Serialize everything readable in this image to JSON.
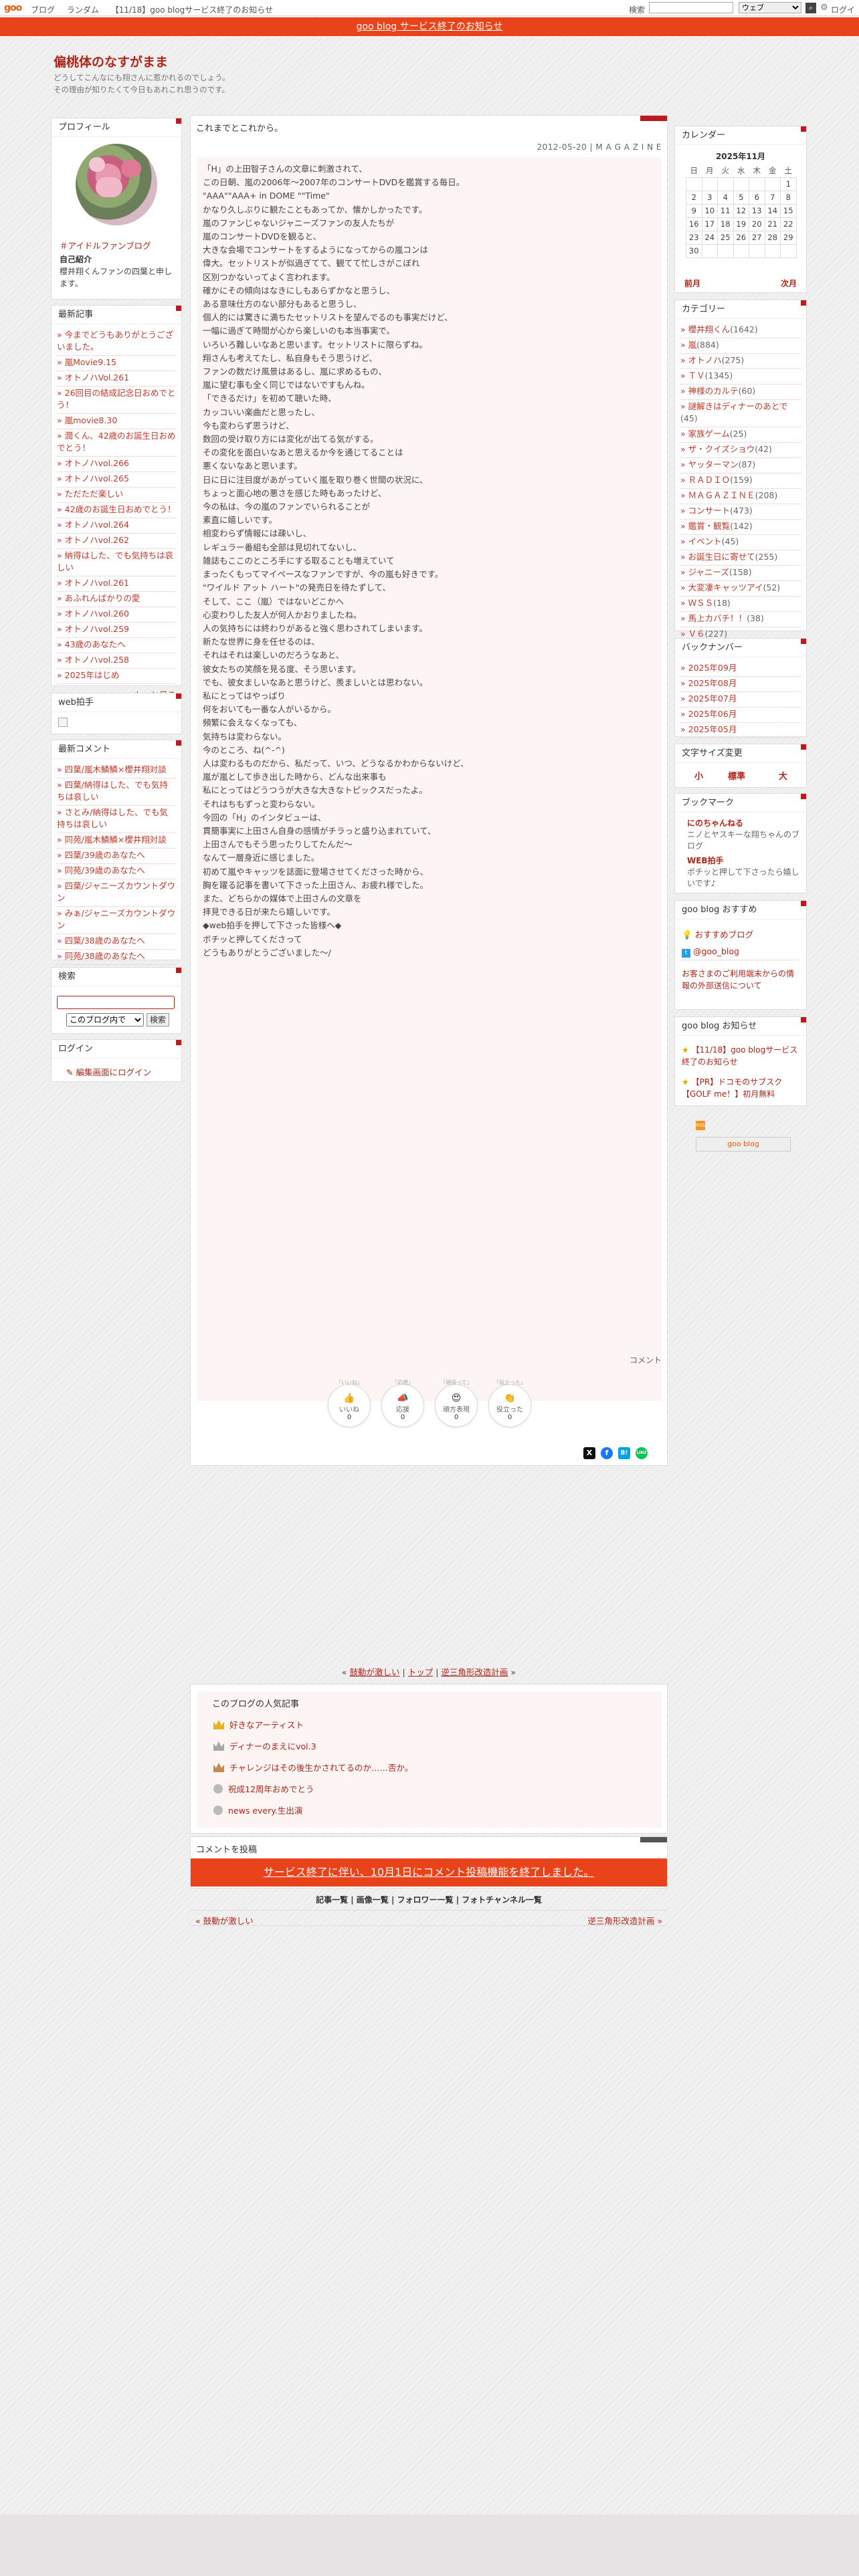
{
  "topbar": {
    "logo": "goo",
    "links": [
      "ブログ",
      "ランダム",
      "【11/18】goo blogサービス終了のお知らせ"
    ],
    "search_label": "検索",
    "search_value": "",
    "search_scope": "ウェブ",
    "login": "ログイン"
  },
  "notice": "goo blog サービス終了のお知らせ",
  "blog": {
    "title": "偏桃体のなすがまま",
    "desc_line1": "どうしてこんなにも翔さんに惹かれるのでしょう。",
    "desc_line2": "その理由が知りたくて今日もあれこれ思うのです。"
  },
  "profile": {
    "heading": "プロフィール",
    "name": "＃アイドルファンブログ",
    "intro_title": "自己紹介",
    "intro": "櫻井翔くんファンの四葉と申します。"
  },
  "recent": {
    "heading": "最新記事",
    "items": [
      "今までどうもありがとうございました。",
      "嵐Movie9.15",
      "オトノハVol.261",
      "26回目の結成記念日おめでとう！",
      "嵐movie8.30",
      "潤くん、42歳のお誕生日おめでとう！",
      "オトノハvol.266",
      "オトノハvol.265",
      "ただただ楽しい",
      "42歳のお誕生日おめでとう！",
      "オトノハvol.264",
      "オトノハvol.262",
      "納得はした、でも気持ちは哀しい",
      "オトノハvol.261",
      "あふれんばかりの愛",
      "オトノハvol.260",
      "オトノハvol.259",
      "43歳のあなたへ",
      "オトノハvol.258",
      "2025年はじめ"
    ],
    "more": ">> もっと見る"
  },
  "webhelper": {
    "heading": "web拍手"
  },
  "comments": {
    "heading": "最新コメント",
    "items": [
      "四葉/嵐木鱗鱗×櫻井翔対談",
      "四葉/納得はした、でも気持ちは哀しい",
      "さとみ/納得はした、でも気持ちは哀しい",
      "同苑/嵐木鱗鱗×櫻井翔対談",
      "四葉/39歳のあなたへ",
      "同苑/39歳のあなたへ",
      "四葉/ジャニーズカウントダウン",
      "みぁ/ジャニーズカウントダウン",
      "四葉/38歳のあなたへ",
      "同苑/38歳のあなたへ"
    ]
  },
  "search": {
    "heading": "検索",
    "value": "",
    "scope": "このブログ内で",
    "button": "検索"
  },
  "login": {
    "heading": "ログイン",
    "link": "編集画面にログイン"
  },
  "article": {
    "title": "これまでとこれから。",
    "meta": "2012-05-20 | M A G A Z I N E",
    "body": [
      "「H」の上田智子さんの文章に刺激されて、",
      "この日朝、嵐の2006年〜2007年のコンサートDVDを鑑賞する毎日。",
      "\"AAA\"\"AAA+ in DOME \"\"Time\"",
      "かなり久しぶりに観たこともあってか、懐かしかったです。",
      "",
      "",
      "嵐のファンじゃないジャニーズファンの友人たちが",
      "嵐のコンサートDVDを観ると、",
      "大きな会場でコンサートをするようになってからの嵐コンは",
      "偉大。セットリストが似過ぎてて、観てて忙しさがこぼれ",
      "区別つかないってよく言われます。",
      "",
      "確かにその傾向はなきにしもあらずかなと思うし、",
      "ある意味仕方のない部分もあると思うし、",
      "個人的には驚きに満ちたセットリストを望んでるのも事実だけど、",
      "一幅に過ぎて時間が心から楽しいのも本当事実で。",
      "",
      "いろいろ難しいなあと思います。セットリストに限らずね。",
      "翔さんも考えてたし、私自身もそう思うけど、",
      "ファンの数だけ風景はあるし、嵐に求めるもの、",
      "嵐に望む事も全く同じではないですもんね。",
      "",
      "「できるだけ」を初めて聴いた時、",
      "カッコいい楽曲だと思ったし、",
      "今も変わらず思うけど、",
      "数回の受け取り方には変化が出てる気がする。",
      "",
      "その変化を面白いなあと思えるか今を通じてることは",
      "悪くないなあと思います。",
      "",
      "",
      "日に日に注目度があがっていく嵐を取り巻く世間の状況に、",
      "ちょっと面心地の悪さを感じた時もあったけど、",
      "今の私は、今の嵐のファンでいられることが",
      "素直に嬉しいです。",
      "",
      "",
      "相変わらず情報には疎いし、",
      "レギュラー番組も全部は見切れてないし、",
      "雑誌もここのところ手にする取ることも増えていて",
      "まったくもってマイペースなファンですが、今の嵐も好きです。",
      "",
      "",
      "\"ワイルド アット ハート\"の発売日を待たずして、",
      "そして、ここ（嵐）ではないどこかへ",
      "心変わりした友人が何人かおりましたね。",
      "人の気持ちには終わりがあると強く思わされてしまいます。",
      "",
      "新たな世界に身を任せるのは、",
      "それはそれは楽しいのだろうなあと、",
      "彼女たちの笑顔を見る度、そう思います。",
      "でも、彼女ましいなあと思うけど、羨ましいとは思わない。",
      "",
      "私にとってはやっぱり",
      "何をおいても一番な人がいるから。",
      "頻繁に会えなくなっても、",
      "気持ちは変わらない。",
      "",
      "",
      "",
      "",
      "今のところ、ね(^-^)",
      "",
      "",
      "",
      "",
      "人は変わるものだから、私だって、いつ、どうなるかわからないけど、",
      "嵐が嵐として歩き出した時から、どんな出来事も",
      "私にとってはどうつうが大きな大きなトピックスだったよ。",
      "それはちもずっと変わらない。",
      "",
      "",
      "今回の「H」のインタビューは、",
      "貫簡事実に上田さん自身の感情がチラっと盛り込まれていて、",
      "上田さんでもそう思ったりしてたんだ〜",
      "なんて一層身近に感じました。",
      "",
      "初めて嵐やキャッツを誌面に登場させてくださった時から、",
      "胸を躍る記事を書いて下さった上田さん、お疲れ様でした。",
      "また、どちらかの媒体で上田さんの文章を",
      "拝見できる日が来たら嬉しいです。",
      "",
      "",
      "◆web拍手を押して下さった皆様へ◆",
      "ボチッと押してくださって",
      "どうもありがとうございました〜/"
    ],
    "comment_label": "コメント",
    "reactions": [
      {
        "top": "「いいね」",
        "label": "いいね",
        "count": "0"
      },
      {
        "top": "「応援」",
        "label": "応援",
        "count": "0"
      },
      {
        "top": "「頑張って」",
        "label": "頑方表現",
        "count": "0"
      },
      {
        "top": "「役立った」",
        "label": "役立った",
        "count": "0"
      }
    ],
    "share": [
      "X",
      "f",
      "B!",
      "LINE"
    ]
  },
  "calendar": {
    "heading": "カレンダー",
    "month": "2025年11月",
    "weekdays": [
      "日",
      "月",
      "火",
      "水",
      "木",
      "金",
      "土"
    ],
    "weeks": [
      [
        "",
        "",
        "",
        "",
        "",
        "",
        "1"
      ],
      [
        "2",
        "3",
        "4",
        "5",
        "6",
        "7",
        "8"
      ],
      [
        "9",
        "10",
        "11",
        "12",
        "13",
        "14",
        "15"
      ],
      [
        "16",
        "17",
        "18",
        "19",
        "20",
        "21",
        "22"
      ],
      [
        "23",
        "24",
        "25",
        "26",
        "27",
        "28",
        "29"
      ],
      [
        "30",
        "",
        "",
        "",
        "",
        "",
        ""
      ]
    ],
    "prev": "前月",
    "next": "次月"
  },
  "categories": {
    "heading": "カテゴリー",
    "items": [
      {
        "name": "櫻井翔くん",
        "count": "(1642)"
      },
      {
        "name": "嵐",
        "count": "(884)"
      },
      {
        "name": "オトノハ",
        "count": "(275)"
      },
      {
        "name": "ＴＶ",
        "count": "(1345)"
      },
      {
        "name": "神様のカルテ",
        "count": "(60)"
      },
      {
        "name": "謎解きはディナーのあとで",
        "count": "(45)"
      },
      {
        "name": "家族ゲーム",
        "count": "(25)"
      },
      {
        "name": "ザ・クイズショウ",
        "count": "(42)"
      },
      {
        "name": "ヤッターマン",
        "count": "(87)"
      },
      {
        "name": "ＲＡＤＩＯ",
        "count": "(159)"
      },
      {
        "name": "ＭＡＧＡＺＩＮＥ",
        "count": "(208)"
      },
      {
        "name": "コンサート",
        "count": "(473)"
      },
      {
        "name": "鑑賞・観覧",
        "count": "(142)"
      },
      {
        "name": "イベント",
        "count": "(45)"
      },
      {
        "name": "お誕生日に寄せて",
        "count": "(255)"
      },
      {
        "name": "ジャニーズ",
        "count": "(158)"
      },
      {
        "name": "大変凄キャッツアイ",
        "count": "(52)"
      },
      {
        "name": "ＷＳＳ",
        "count": "(18)"
      },
      {
        "name": "馬上カバチ！！",
        "count": "(38)"
      },
      {
        "name": "Ｖ６",
        "count": "(227)"
      }
    ]
  },
  "backnumber": {
    "heading": "バックナンバー",
    "items": [
      "2025年09月",
      "2025年08月",
      "2025年07月",
      "2025年06月",
      "2025年05月"
    ]
  },
  "fontsize": {
    "heading": "文字サイズ変更",
    "small": "小",
    "normal": "標準",
    "large": "大"
  },
  "bookmark": {
    "heading": "ブックマーク",
    "items": [
      {
        "title": "にのちゃんねる",
        "desc": "ニノとヤスキーな翔ちゃんのブログ"
      },
      {
        "title": "WEB拍手",
        "desc": "ポチッと押して下さったら嬉しいです♪"
      }
    ]
  },
  "recommend": {
    "heading": "goo blog おすすめ",
    "item1": "おすすめブログ",
    "item2": "@goo_blog",
    "notice": "お客さまのご利用端末からの情報の外部送信について"
  },
  "gooinfo": {
    "heading": "goo blog お知らせ",
    "items": [
      "【11/18】goo blogサービス終了のお知らせ",
      "【PR】ドコモのサブスク【GOLF me！】初月無料"
    ],
    "rss": "RSS",
    "badge": "goo blog"
  },
  "pager_top": {
    "prev": "鼓動が激しい",
    "top": "トップ",
    "next": "逆三角形改造計画"
  },
  "popular": {
    "heading": "このブログの人気記事",
    "items": [
      "好きなアーティスト",
      "ディナーのまえにvol.3",
      "チャレンジはその後生かされてるのか……否か。",
      "祝成12周年おめでとう",
      "news every.生出演"
    ]
  },
  "comment_post": {
    "heading": "コメントを投稿",
    "note": "サービス終了に伴い、10月1日にコメント投稿機能を終了しました。"
  },
  "bottom_links": "記事一覧 | 画像一覧 | フォロワー一覧 | フォトチャンネル一覧",
  "pager_bottom": {
    "prev": "« 鼓動が激しい",
    "next": "逆三角形改造計画 »"
  },
  "colors": {
    "accent": "#c0181f",
    "notice": "#e8431a",
    "link": "#c0392b",
    "article_bg": "#fdf4f4"
  }
}
